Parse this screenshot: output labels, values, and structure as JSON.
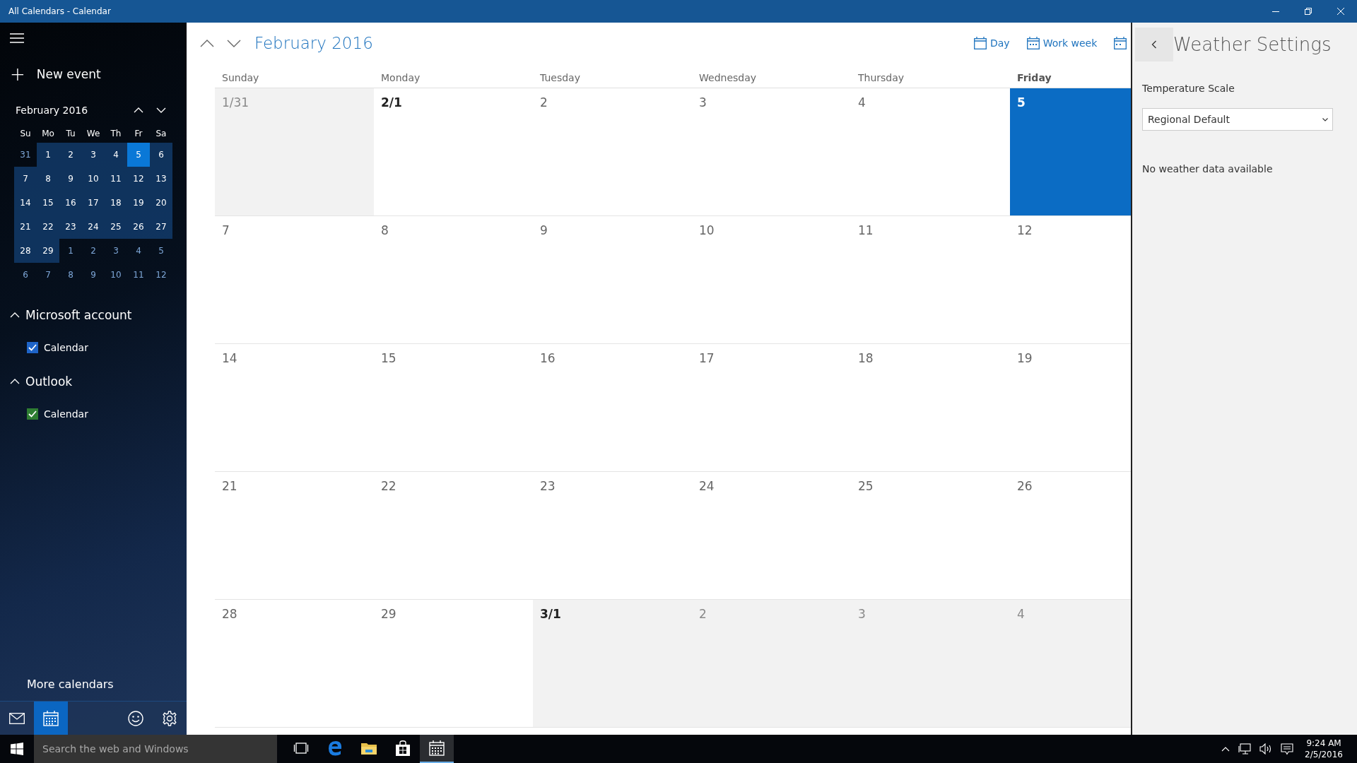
{
  "window": {
    "title": "All Calendars - Calendar"
  },
  "sidebar": {
    "new_event": {
      "icon": "+",
      "label": "New event"
    },
    "mini_calendar": {
      "title": "February 2016",
      "weekdays": [
        "Su",
        "Mo",
        "Tu",
        "We",
        "Th",
        "Fr",
        "Sa"
      ],
      "weeks": [
        [
          {
            "text": "31",
            "in_month": false,
            "selected": false
          },
          {
            "text": "1",
            "in_month": true,
            "selected": false
          },
          {
            "text": "2",
            "in_month": true,
            "selected": false
          },
          {
            "text": "3",
            "in_month": true,
            "selected": false
          },
          {
            "text": "4",
            "in_month": true,
            "selected": false
          },
          {
            "text": "5",
            "in_month": true,
            "selected": true
          },
          {
            "text": "6",
            "in_month": true,
            "selected": false
          }
        ],
        [
          {
            "text": "7",
            "in_month": true,
            "selected": false
          },
          {
            "text": "8",
            "in_month": true,
            "selected": false
          },
          {
            "text": "9",
            "in_month": true,
            "selected": false
          },
          {
            "text": "10",
            "in_month": true,
            "selected": false
          },
          {
            "text": "11",
            "in_month": true,
            "selected": false
          },
          {
            "text": "12",
            "in_month": true,
            "selected": false
          },
          {
            "text": "13",
            "in_month": true,
            "selected": false
          }
        ],
        [
          {
            "text": "14",
            "in_month": true,
            "selected": false
          },
          {
            "text": "15",
            "in_month": true,
            "selected": false
          },
          {
            "text": "16",
            "in_month": true,
            "selected": false
          },
          {
            "text": "17",
            "in_month": true,
            "selected": false
          },
          {
            "text": "18",
            "in_month": true,
            "selected": false
          },
          {
            "text": "19",
            "in_month": true,
            "selected": false
          },
          {
            "text": "20",
            "in_month": true,
            "selected": false
          }
        ],
        [
          {
            "text": "21",
            "in_month": true,
            "selected": false
          },
          {
            "text": "22",
            "in_month": true,
            "selected": false
          },
          {
            "text": "23",
            "in_month": true,
            "selected": false
          },
          {
            "text": "24",
            "in_month": true,
            "selected": false
          },
          {
            "text": "25",
            "in_month": true,
            "selected": false
          },
          {
            "text": "26",
            "in_month": true,
            "selected": false
          },
          {
            "text": "27",
            "in_month": true,
            "selected": false
          }
        ],
        [
          {
            "text": "28",
            "in_month": true,
            "selected": false
          },
          {
            "text": "29",
            "in_month": true,
            "selected": false
          },
          {
            "text": "1",
            "in_month": false,
            "selected": false
          },
          {
            "text": "2",
            "in_month": false,
            "selected": false
          },
          {
            "text": "3",
            "in_month": false,
            "selected": false
          },
          {
            "text": "4",
            "in_month": false,
            "selected": false
          },
          {
            "text": "5",
            "in_month": false,
            "selected": false
          }
        ],
        [
          {
            "text": "6",
            "in_month": false,
            "selected": false
          },
          {
            "text": "7",
            "in_month": false,
            "selected": false
          },
          {
            "text": "8",
            "in_month": false,
            "selected": false
          },
          {
            "text": "9",
            "in_month": false,
            "selected": false
          },
          {
            "text": "10",
            "in_month": false,
            "selected": false
          },
          {
            "text": "11",
            "in_month": false,
            "selected": false
          },
          {
            "text": "12",
            "in_month": false,
            "selected": false
          }
        ]
      ]
    },
    "accounts": [
      {
        "name": "Microsoft account",
        "expanded": true,
        "calendars": [
          {
            "label": "Calendar",
            "checked": true,
            "color": "#1e64c8"
          }
        ]
      },
      {
        "name": "Outlook",
        "expanded": true,
        "calendars": [
          {
            "label": "Calendar",
            "checked": true,
            "color": "#2e7d32"
          }
        ]
      }
    ],
    "more_calendars": "More calendars",
    "bottom_bar": [
      {
        "kind": "mail",
        "selected": false
      },
      {
        "kind": "calendar",
        "selected": true
      },
      {
        "kind": "feedback",
        "selected": false
      },
      {
        "kind": "settings",
        "selected": false
      }
    ]
  },
  "main": {
    "title": "February 2016",
    "views": [
      {
        "kind": "day",
        "label": "Day"
      },
      {
        "kind": "workweek",
        "label": "Work week"
      },
      {
        "kind": "week"
      }
    ],
    "day_names": [
      {
        "text": "Sunday",
        "today": false
      },
      {
        "text": "Monday",
        "today": false
      },
      {
        "text": "Tuesday",
        "today": false
      },
      {
        "text": "Wednesday",
        "today": false
      },
      {
        "text": "Thursday",
        "today": false
      },
      {
        "text": "Friday",
        "today": true
      }
    ],
    "weeks": [
      [
        {
          "text": "1/31",
          "in_month": false,
          "bold": false,
          "selected": false
        },
        {
          "text": "2/1",
          "in_month": true,
          "bold": true,
          "selected": false
        },
        {
          "text": "2",
          "in_month": true,
          "bold": false,
          "selected": false
        },
        {
          "text": "3",
          "in_month": true,
          "bold": false,
          "selected": false
        },
        {
          "text": "4",
          "in_month": true,
          "bold": false,
          "selected": false
        },
        {
          "text": "5",
          "in_month": true,
          "bold": true,
          "selected": true
        }
      ],
      [
        {
          "text": "7",
          "in_month": true,
          "bold": false,
          "selected": false
        },
        {
          "text": "8",
          "in_month": true,
          "bold": false,
          "selected": false
        },
        {
          "text": "9",
          "in_month": true,
          "bold": false,
          "selected": false
        },
        {
          "text": "10",
          "in_month": true,
          "bold": false,
          "selected": false
        },
        {
          "text": "11",
          "in_month": true,
          "bold": false,
          "selected": false
        },
        {
          "text": "12",
          "in_month": true,
          "bold": false,
          "selected": false
        }
      ],
      [
        {
          "text": "14",
          "in_month": true,
          "bold": false,
          "selected": false
        },
        {
          "text": "15",
          "in_month": true,
          "bold": false,
          "selected": false
        },
        {
          "text": "16",
          "in_month": true,
          "bold": false,
          "selected": false
        },
        {
          "text": "17",
          "in_month": true,
          "bold": false,
          "selected": false
        },
        {
          "text": "18",
          "in_month": true,
          "bold": false,
          "selected": false
        },
        {
          "text": "19",
          "in_month": true,
          "bold": false,
          "selected": false
        }
      ],
      [
        {
          "text": "21",
          "in_month": true,
          "bold": false,
          "selected": false
        },
        {
          "text": "22",
          "in_month": true,
          "bold": false,
          "selected": false
        },
        {
          "text": "23",
          "in_month": true,
          "bold": false,
          "selected": false
        },
        {
          "text": "24",
          "in_month": true,
          "bold": false,
          "selected": false
        },
        {
          "text": "25",
          "in_month": true,
          "bold": false,
          "selected": false
        },
        {
          "text": "26",
          "in_month": true,
          "bold": false,
          "selected": false
        }
      ],
      [
        {
          "text": "28",
          "in_month": true,
          "bold": false,
          "selected": false
        },
        {
          "text": "29",
          "in_month": true,
          "bold": false,
          "selected": false
        },
        {
          "text": "3/1",
          "in_month": false,
          "bold": true,
          "selected": false
        },
        {
          "text": "2",
          "in_month": false,
          "bold": false,
          "selected": false
        },
        {
          "text": "3",
          "in_month": false,
          "bold": false,
          "selected": false
        },
        {
          "text": "4",
          "in_month": false,
          "bold": false,
          "selected": false
        }
      ]
    ]
  },
  "weather_panel": {
    "title": "Weather Settings",
    "label": "Temperature Scale",
    "select_value": "Regional Default",
    "message": "No weather data available"
  },
  "taskbar": {
    "search": {
      "placeholder": "Search the web and Windows"
    },
    "apps": [
      {
        "kind": "taskview",
        "active": false
      },
      {
        "kind": "browser",
        "active": false
      },
      {
        "kind": "folder",
        "active": false
      },
      {
        "kind": "store",
        "active": false
      },
      {
        "kind": "calendar",
        "active": true
      }
    ],
    "time": "9:24 AM",
    "date": "2/5/2016"
  }
}
